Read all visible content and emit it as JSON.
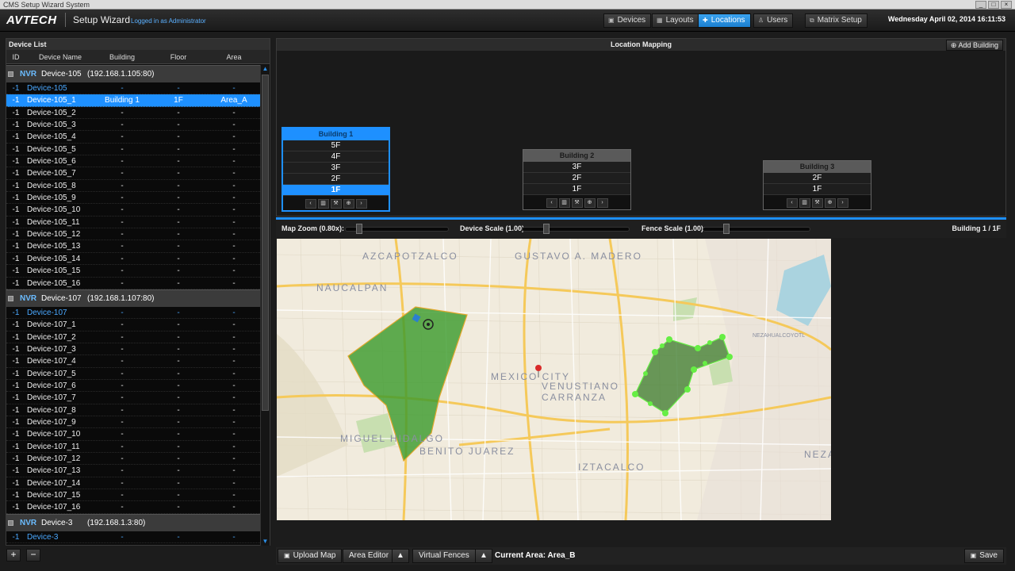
{
  "window": {
    "title": "CMS Setup Wizard System"
  },
  "header": {
    "logo": "AVTECH",
    "app_name": "Setup Wizard",
    "logged_in": "Logged in as Administrator",
    "nav": [
      {
        "label": "Devices",
        "icon": "devices-icon"
      },
      {
        "label": "Layouts",
        "icon": "layouts-icon"
      },
      {
        "label": "Locations",
        "icon": "pin-icon",
        "active": true
      },
      {
        "label": "Users",
        "icon": "users-icon"
      }
    ],
    "matrix_setup": "Matrix Setup",
    "datetime": "Wednesday April 02, 2014   16:11:53"
  },
  "device_list": {
    "title": "Device List",
    "columns": [
      "ID",
      "Device Name",
      "Building",
      "Floor",
      "Area"
    ],
    "groups": [
      {
        "type": "NVR",
        "name": "Device-105",
        "ip": "(192.168.1.105:80)",
        "rows": [
          {
            "id": "-1",
            "name": "Device-105",
            "building": "-",
            "floor": "-",
            "area": "-",
            "parent": true
          },
          {
            "id": "-1",
            "name": "Device-105_1",
            "building": "Building 1",
            "floor": "1F",
            "area": "Area_A",
            "selected": true
          },
          {
            "id": "-1",
            "name": "Device-105_2",
            "building": "-",
            "floor": "-",
            "area": "-"
          },
          {
            "id": "-1",
            "name": "Device-105_3",
            "building": "-",
            "floor": "-",
            "area": "-"
          },
          {
            "id": "-1",
            "name": "Device-105_4",
            "building": "-",
            "floor": "-",
            "area": "-"
          },
          {
            "id": "-1",
            "name": "Device-105_5",
            "building": "-",
            "floor": "-",
            "area": "-"
          },
          {
            "id": "-1",
            "name": "Device-105_6",
            "building": "-",
            "floor": "-",
            "area": "-"
          },
          {
            "id": "-1",
            "name": "Device-105_7",
            "building": "-",
            "floor": "-",
            "area": "-"
          },
          {
            "id": "-1",
            "name": "Device-105_8",
            "building": "-",
            "floor": "-",
            "area": "-"
          },
          {
            "id": "-1",
            "name": "Device-105_9",
            "building": "-",
            "floor": "-",
            "area": "-"
          },
          {
            "id": "-1",
            "name": "Device-105_10",
            "building": "-",
            "floor": "-",
            "area": "-"
          },
          {
            "id": "-1",
            "name": "Device-105_11",
            "building": "-",
            "floor": "-",
            "area": "-"
          },
          {
            "id": "-1",
            "name": "Device-105_12",
            "building": "-",
            "floor": "-",
            "area": "-"
          },
          {
            "id": "-1",
            "name": "Device-105_13",
            "building": "-",
            "floor": "-",
            "area": "-"
          },
          {
            "id": "-1",
            "name": "Device-105_14",
            "building": "-",
            "floor": "-",
            "area": "-"
          },
          {
            "id": "-1",
            "name": "Device-105_15",
            "building": "-",
            "floor": "-",
            "area": "-"
          },
          {
            "id": "-1",
            "name": "Device-105_16",
            "building": "-",
            "floor": "-",
            "area": "-"
          }
        ]
      },
      {
        "type": "NVR",
        "name": "Device-107",
        "ip": "(192.168.1.107:80)",
        "rows": [
          {
            "id": "-1",
            "name": "Device-107",
            "building": "-",
            "floor": "-",
            "area": "-",
            "parent": true
          },
          {
            "id": "-1",
            "name": "Device-107_1",
            "building": "-",
            "floor": "-",
            "area": "-"
          },
          {
            "id": "-1",
            "name": "Device-107_2",
            "building": "-",
            "floor": "-",
            "area": "-"
          },
          {
            "id": "-1",
            "name": "Device-107_3",
            "building": "-",
            "floor": "-",
            "area": "-"
          },
          {
            "id": "-1",
            "name": "Device-107_4",
            "building": "-",
            "floor": "-",
            "area": "-"
          },
          {
            "id": "-1",
            "name": "Device-107_5",
            "building": "-",
            "floor": "-",
            "area": "-"
          },
          {
            "id": "-1",
            "name": "Device-107_6",
            "building": "-",
            "floor": "-",
            "area": "-"
          },
          {
            "id": "-1",
            "name": "Device-107_7",
            "building": "-",
            "floor": "-",
            "area": "-"
          },
          {
            "id": "-1",
            "name": "Device-107_8",
            "building": "-",
            "floor": "-",
            "area": "-"
          },
          {
            "id": "-1",
            "name": "Device-107_9",
            "building": "-",
            "floor": "-",
            "area": "-"
          },
          {
            "id": "-1",
            "name": "Device-107_10",
            "building": "-",
            "floor": "-",
            "area": "-"
          },
          {
            "id": "-1",
            "name": "Device-107_11",
            "building": "-",
            "floor": "-",
            "area": "-"
          },
          {
            "id": "-1",
            "name": "Device-107_12",
            "building": "-",
            "floor": "-",
            "area": "-"
          },
          {
            "id": "-1",
            "name": "Device-107_13",
            "building": "-",
            "floor": "-",
            "area": "-"
          },
          {
            "id": "-1",
            "name": "Device-107_14",
            "building": "-",
            "floor": "-",
            "area": "-"
          },
          {
            "id": "-1",
            "name": "Device-107_15",
            "building": "-",
            "floor": "-",
            "area": "-"
          },
          {
            "id": "-1",
            "name": "Device-107_16",
            "building": "-",
            "floor": "-",
            "area": "-"
          }
        ]
      },
      {
        "type": "NVR",
        "name": "Device-3",
        "ip": "(192.168.1.3:80)",
        "rows": [
          {
            "id": "-1",
            "name": "Device-3",
            "building": "-",
            "floor": "-",
            "area": "-",
            "parent": true
          }
        ]
      }
    ],
    "add_label": "+",
    "remove_label": "−"
  },
  "location_mapping": {
    "title": "Location Mapping",
    "add_building": "Add Building",
    "buildings": [
      {
        "name": "Building 1",
        "floors": [
          "5F",
          "4F",
          "3F",
          "2F",
          "1F"
        ],
        "selected_floor": "1F",
        "selected": true
      },
      {
        "name": "Building 2",
        "floors": [
          "3F",
          "2F",
          "1F"
        ]
      },
      {
        "name": "Building 3",
        "floors": [
          "2F",
          "1F"
        ]
      }
    ],
    "map_zoom": "Map Zoom (0.80x):",
    "device_scale": "Device Scale (1.00):",
    "fence_scale": "Fence Scale (1.00):",
    "current_floor": "Building 1 / 1F",
    "map_labels": {
      "azcapotzalco": "AZCAPOTZALCO",
      "gustavo": "GUSTAVO A. MADERO",
      "naucalpan": "NAUCALPAN",
      "mexico_city": "MEXICO CITY",
      "venustiano": "VENUSTIANO",
      "carranza": "CARRANZA",
      "miguel": "MIGUEL HIDALGO",
      "benito": "BENITO JUAREZ",
      "iztacalco": "IZTACALCO",
      "nezahualcoyotl": "NEZAHUALCOYOTL",
      "neza": "NEZA"
    }
  },
  "bottom": {
    "upload_map": "Upload Map",
    "area_editor": "Area Editor",
    "virtual_fences": "Virtual Fences",
    "current_area": "Current Area: Area_B",
    "save": "Save"
  },
  "colors": {
    "accent": "#1e90ff",
    "fence_fill": "#3a9a2a",
    "fence_node": "#66ee44",
    "map_bg": "#f1ebdd"
  }
}
